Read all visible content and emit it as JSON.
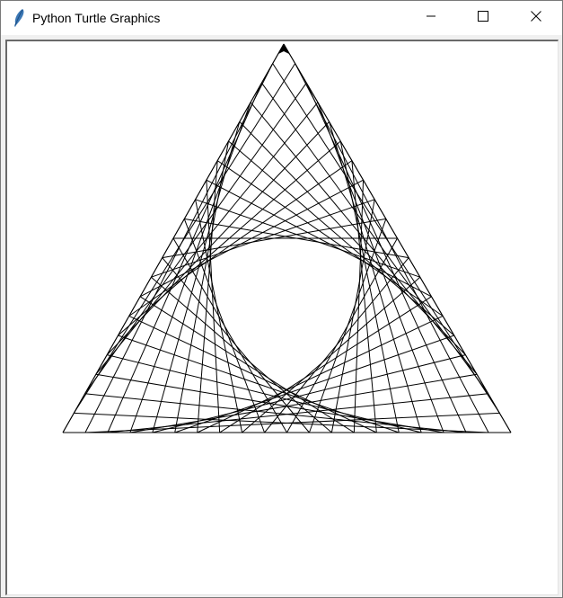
{
  "window": {
    "title": "Python Turtle Graphics",
    "icon": "feather-icon"
  },
  "controls": {
    "minimize": "minimize-icon",
    "maximize": "maximize-icon",
    "close": "close-icon"
  },
  "drawing": {
    "figure": "envelope of lines connecting points on the sides of an equilateral triangle",
    "line_color": "#000000",
    "background_color": "#ffffff",
    "divisions_per_side": 20,
    "turtle_heading": "up"
  }
}
